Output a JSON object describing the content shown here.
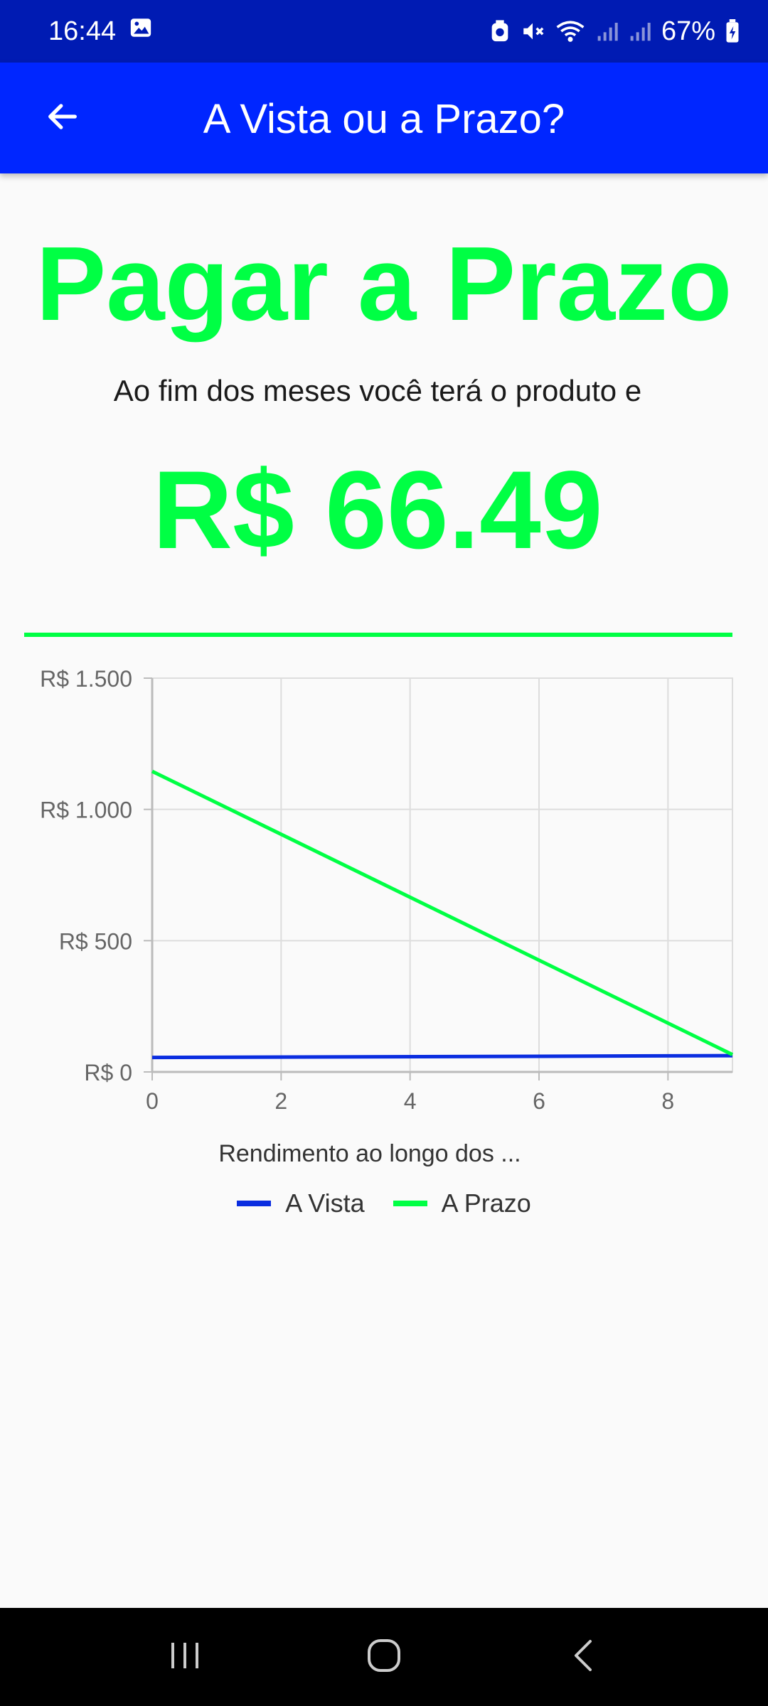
{
  "status_bar": {
    "time": "16:44",
    "battery": "67%",
    "icons": [
      "image-icon",
      "data-saver-icon",
      "mute-icon",
      "wifi-icon",
      "signal-icon",
      "signal-icon-2",
      "battery-charging-icon"
    ]
  },
  "app_bar": {
    "title": "A Vista ou a Prazo?",
    "back_icon": "arrow-left-icon"
  },
  "main": {
    "headline": "Pagar a Prazo",
    "subtitle": "Ao fim dos meses você terá o produto e",
    "amount": "R$ 66.49"
  },
  "colors": {
    "status_bar": "#001bb3",
    "app_bar": "#0026ff",
    "accent_green": "#00ff44",
    "series_a_vista": "#0a2de0",
    "series_a_prazo": "#00ff44"
  },
  "chart_data": {
    "type": "line",
    "xlabel": "Rendimento ao longo dos ...",
    "ylabel": "",
    "xlim": [
      0,
      9
    ],
    "ylim": [
      0,
      1500
    ],
    "x_ticks": [
      "0",
      "2",
      "4",
      "6",
      "8"
    ],
    "y_ticks": [
      "R$ 0",
      "R$ 500",
      "R$ 1.000",
      "R$ 1.500"
    ],
    "grid": true,
    "legend": "bottom",
    "series": [
      {
        "name": "A Vista",
        "x": [
          0,
          9
        ],
        "values": [
          55,
          62
        ]
      },
      {
        "name": "A Prazo",
        "x": [
          0,
          9
        ],
        "values": [
          1145,
          66
        ]
      }
    ]
  },
  "nav_bar": {
    "buttons": [
      "recent-apps-icon",
      "home-icon",
      "back-nav-icon"
    ]
  }
}
